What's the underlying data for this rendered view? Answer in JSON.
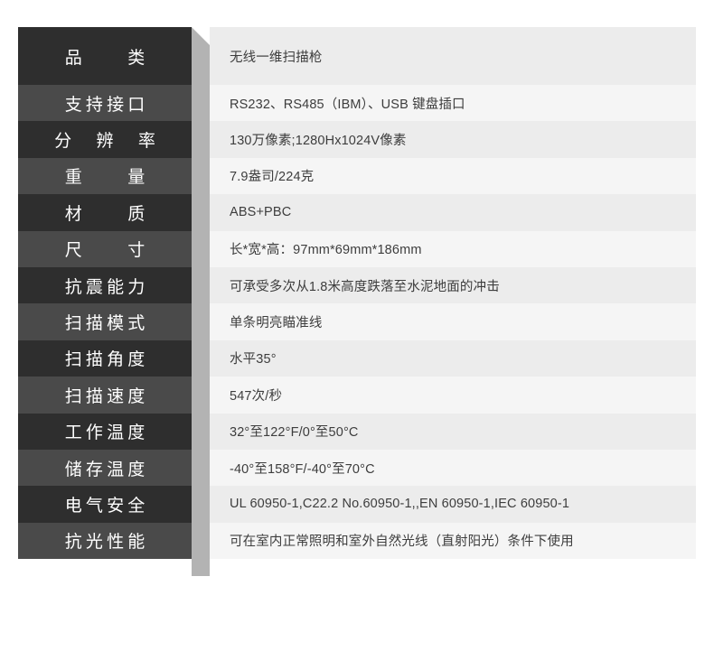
{
  "sheet": {
    "title": "无线一维扫描枪产品参数表",
    "colors": {
      "label_bg_odd": "#2e2e2e",
      "label_bg_even": "#4a4a4a",
      "label_text": "#ffffff",
      "value_bg_odd": "#ececec",
      "value_bg_even": "#f5f5f5",
      "value_text": "#3d3d3d",
      "shadow": "#b3b3b3",
      "page_bg": "#ffffff"
    },
    "rows": [
      {
        "label": "品　　类",
        "value": "无线一维扫描枪"
      },
      {
        "label": "支持接口",
        "value": "RS232、RS485（IBM）、USB 键盘插口"
      },
      {
        "label": "分　辨　率",
        "value": "130万像素;1280Hx1024V像素"
      },
      {
        "label": "重　　量",
        "value": "7.9盎司/224克"
      },
      {
        "label": "材　　质",
        "value": "ABS+PBC"
      },
      {
        "label": "尺　　寸",
        "value": "长*宽*高：97mm*69mm*186mm"
      },
      {
        "label": "抗震能力",
        "value": "可承受多次从1.8米高度跌落至水泥地面的冲击"
      },
      {
        "label": "扫描模式",
        "value": "单条明亮瞄准线"
      },
      {
        "label": "扫描角度",
        "value": "水平35°"
      },
      {
        "label": "扫描速度",
        "value": "547次/秒"
      },
      {
        "label": "工作温度",
        "value": "32°至122°F/0°至50°C"
      },
      {
        "label": "储存温度",
        "value": "-40°至158°F/-40°至70°C"
      },
      {
        "label": "电气安全",
        "value": "UL 60950-1,C22.2 No.60950-1,,EN 60950-1,IEC 60950-1"
      },
      {
        "label": "抗光性能",
        "value": "可在室内正常照明和室外自然光线（直射阳光）条件下使用"
      }
    ]
  }
}
